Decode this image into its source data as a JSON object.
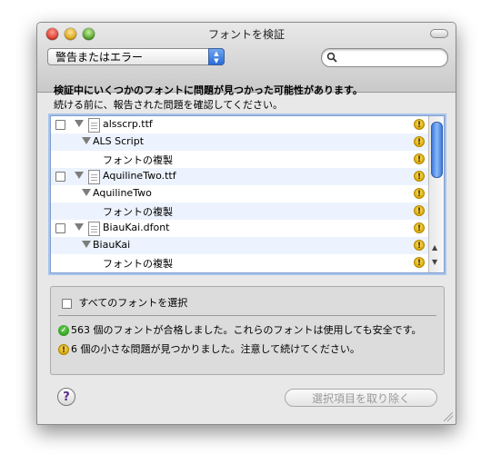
{
  "window": {
    "title": "フォントを検証"
  },
  "toolbar": {
    "filter_value": "警告またはエラー",
    "search_placeholder": ""
  },
  "message": {
    "line1": "検証中にいくつかのフォントに問題が見つかった可能性があります。",
    "line2": "続ける前に、報告された問題を確認してください。"
  },
  "list": {
    "rows": [
      {
        "label": "alsscrp.ttf"
      },
      {
        "label": "ALS Script"
      },
      {
        "label": "フォントの複製"
      },
      {
        "label": "AquilineTwo.ttf"
      },
      {
        "label": "AquilineTwo"
      },
      {
        "label": "フォントの複製"
      },
      {
        "label": "BiauKai.dfont"
      },
      {
        "label": "BiauKai"
      },
      {
        "label": "フォントの複製"
      }
    ],
    "warning_glyph": "!"
  },
  "summary": {
    "select_all_label": "すべてのフォントを選択",
    "passed_text": "563 個のフォントが合格しました。これらのフォントは使用しても安全です。",
    "warning_text": "6 個の小さな問題が見つかりました。注意して続けてください。"
  },
  "buttons": {
    "help_label": "?",
    "remove_label": "選択項目を取り除く"
  },
  "colors": {
    "accent": "#3d7be0",
    "warning": "#e8b400",
    "ok": "#2a9a1c"
  }
}
